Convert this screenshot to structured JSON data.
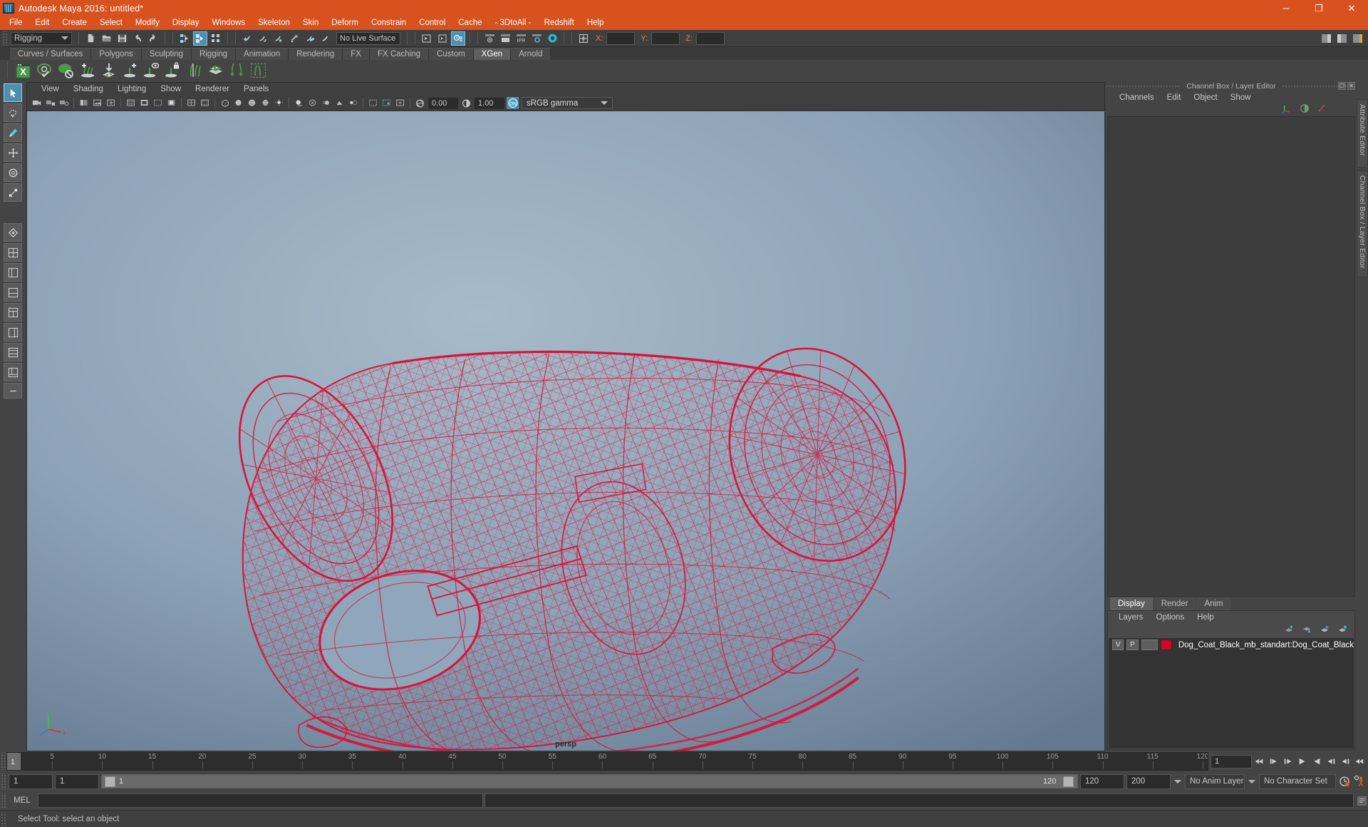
{
  "window": {
    "title": "Autodesk Maya 2016: untitled*",
    "app_icon": "maya-logo-icon",
    "controls": [
      {
        "name": "minimize-button",
        "glyph": "─"
      },
      {
        "name": "maximize-button",
        "glyph": "❐"
      },
      {
        "name": "close-button",
        "glyph": "✕"
      }
    ]
  },
  "menubar": {
    "items": [
      "File",
      "Edit",
      "Create",
      "Select",
      "Modify",
      "Display",
      "Windows",
      "Skeleton",
      "Skin",
      "Deform",
      "Constrain",
      "Control",
      "Cache",
      "- 3DtoAll -",
      "Redshift",
      "Help"
    ]
  },
  "statusline": {
    "menu_set": "Rigging",
    "live_surface": "No Live Surface",
    "coord_labels": {
      "x": "X:",
      "y": "Y:",
      "z": "Z:"
    },
    "coord_values": {
      "x": "",
      "y": "",
      "z": ""
    },
    "icons": [
      "new-scene-icon",
      "open-scene-icon",
      "save-scene-icon",
      "undo-icon",
      "redo-icon",
      "select-hierarchy-icon",
      "select-object-icon",
      "select-component-icon",
      "snap-grid-icon",
      "snap-curve-icon",
      "snap-point-icon",
      "snap-view-plane-icon",
      "make-live-icon",
      "snap-projected-icon",
      "open-render-view-icon",
      "render-current-frame-icon",
      "ipr-render-icon",
      "render-settings-icon",
      "hypershade-icon",
      "editor-toggle-icon"
    ]
  },
  "shelf": {
    "tabs": [
      "Curves / Surfaces",
      "Polygons",
      "Sculpting",
      "Rigging",
      "Animation",
      "Rendering",
      "FX",
      "FX Caching",
      "Custom",
      "XGen",
      "Arnold"
    ],
    "active_tab": "XGen",
    "icons": [
      "xgen-window-icon",
      "xgen-preview-icon",
      "xgen-disable-preview-icon",
      "xgen-add-guides-icon",
      "xgen-import-collection-icon",
      "xgen-add-description-icon",
      "xgen-preview-description-icon",
      "xgen-lock-description-icon",
      "xgen-guide-tools-icon",
      "xgen-patches-icon",
      "xgen-distribute-icon",
      "xgen-region-icon"
    ]
  },
  "tool_column": {
    "items": [
      "select-tool",
      "lasso-select-tool",
      "paint-select-tool",
      "move-tool",
      "rotate-tool",
      "scale-tool",
      "last-tool-used",
      "layout-four-view-icon",
      "layout-outliner-persp-icon",
      "layout-persp-graph-icon",
      "layout-hypershade-persp-icon",
      "layout-persp-icon",
      "layout-two-pane-icon",
      "layout-single-icon",
      "layout-more-icon"
    ],
    "selected": "select-tool"
  },
  "viewport": {
    "panel_menus": [
      "View",
      "Shading",
      "Lighting",
      "Show",
      "Renderer",
      "Panels"
    ],
    "camera_label": "persp",
    "exposure": "0.00",
    "gamma": "1.00",
    "color_management": "sRGB gamma",
    "color_management_enabled": "ON",
    "toolbar_icons": [
      "select-camera-icon",
      "lock-camera-icon",
      "camera-attributes-icon",
      "bookmarks-icon",
      "image-plane-icon",
      "2d-pan-zoom-icon",
      "grid-toggle-icon",
      "film-gate-icon",
      "resolution-gate-icon",
      "gate-mask-icon",
      "field-chart-icon",
      "safe-action-icon",
      "safe-title-icon",
      "wireframe-icon",
      "smooth-shade-icon",
      "shaded-wireframe-icon",
      "textured-icon",
      "use-lights-icon",
      "shadows-icon",
      "screen-space-ao-icon",
      "motion-blur-icon",
      "multisample-icon",
      "depth-of-field-icon",
      "isolate-select-icon",
      "xray-icon",
      "xray-joints-icon",
      "xray-active-components-icon",
      "exposure-icon",
      "gamma-icon",
      "color-management-toggle-icon"
    ],
    "model": {
      "name": "Dog_Coat_Black",
      "display": "wireframe",
      "wire_color": "#d8143c"
    }
  },
  "right_panel": {
    "title": "Channel Box / Layer Editor",
    "title_buttons": [
      "undock-button",
      "close-button"
    ],
    "channelbox_menus": [
      "Channels",
      "Edit",
      "Object",
      "Show"
    ],
    "header_icons": [
      "channel-box-icon",
      "attribute-editor-icon",
      "quick-layout-icon"
    ],
    "layer_editor": {
      "tabs": [
        "Display",
        "Render",
        "Anim"
      ],
      "active_tab": "Display",
      "menus": [
        "Layers",
        "Options",
        "Help"
      ],
      "tool_icons": [
        "move-layer-up-icon",
        "move-layer-down-icon",
        "new-layer-icon",
        "new-layer-from-selected-icon"
      ],
      "columns": [
        "V",
        "P"
      ],
      "layers": [
        {
          "visible": "V",
          "playback": "P",
          "color": "#c80a28",
          "name": "Dog_Coat_Black_mb_standart:Dog_Coat_Black"
        }
      ]
    }
  },
  "vertical_tabs": [
    "Attribute Editor",
    "Channel Box / Layer Editor"
  ],
  "timeline": {
    "current_frame": "1",
    "ticks": [
      5,
      10,
      15,
      20,
      25,
      30,
      35,
      40,
      45,
      50,
      55,
      60,
      65,
      70,
      75,
      80,
      85,
      90,
      95,
      100,
      105,
      110,
      115,
      120
    ],
    "start": 1,
    "end": 120,
    "frame_field": "1",
    "playback_buttons": [
      "go-to-start-icon",
      "step-back-key-icon",
      "step-back-frame-icon",
      "play-backwards-icon",
      "play-forwards-icon",
      "step-forward-frame-icon",
      "step-forward-key-icon",
      "go-to-end-icon"
    ]
  },
  "range_slider": {
    "anim_start": "1",
    "range_start": "1",
    "slider_label": "1",
    "slider_end_label": "120",
    "range_end": "120",
    "anim_end": "200",
    "anim_layer": "No Anim Layer",
    "character_set": "No Character Set",
    "auto_key_icon": "auto-keyframe-icon",
    "anim_prefs_icon": "animation-preferences-icon"
  },
  "command_line": {
    "label": "MEL",
    "input_value": "",
    "output_value": "",
    "script_editor_icon": "script-editor-icon"
  },
  "help_line": {
    "text": "Select Tool: select an object"
  },
  "colors": {
    "title_bar": "#d8521f",
    "panel_bg": "#444444",
    "accent_blue": "#4d8aa8",
    "wire_red": "#d8143c",
    "xgen_green": "#4a9a4a"
  }
}
